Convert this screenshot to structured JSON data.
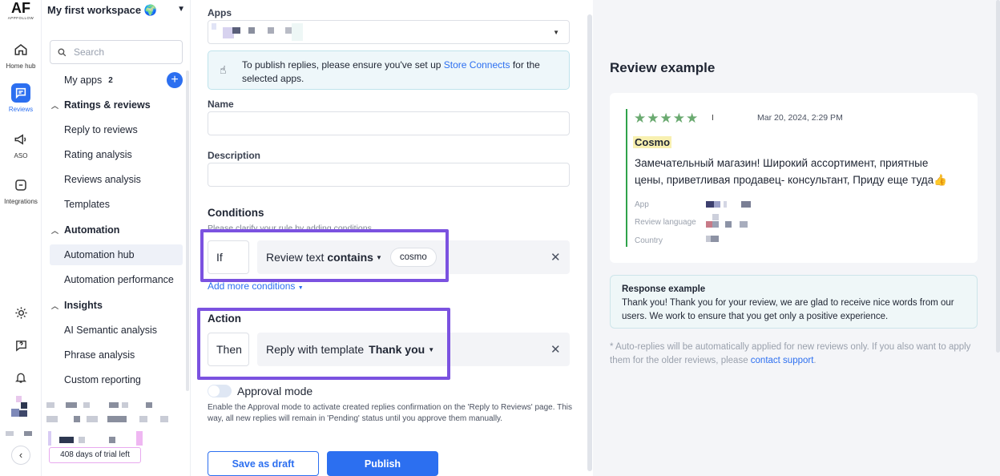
{
  "logo": {
    "mark": "AF",
    "sub": "APPFOLLOW"
  },
  "rail": {
    "items": [
      {
        "label": "Home hub"
      },
      {
        "label": "Reviews"
      },
      {
        "label": "ASO"
      },
      {
        "label": "Integrations"
      }
    ]
  },
  "sidebar": {
    "workspace": "My first workspace 🌍",
    "search_placeholder": "Search",
    "my_apps": {
      "label": "My apps",
      "count": "2"
    },
    "sections": [
      {
        "title": "Ratings & reviews",
        "items": [
          "Reply to reviews",
          "Rating analysis",
          "Reviews analysis",
          "Templates"
        ]
      },
      {
        "title": "Automation",
        "items": [
          "Automation hub",
          "Automation performance"
        ]
      },
      {
        "title": "Insights",
        "items": [
          "AI Semantic analysis",
          "Phrase analysis",
          "Custom reporting"
        ]
      }
    ],
    "trial": "408 days of trial left"
  },
  "form": {
    "apps_label": "Apps",
    "note": {
      "prefix": "To publish replies, please ensure you've set up ",
      "link": "Store Connects",
      "suffix": " for the selected apps."
    },
    "name_label": "Name",
    "description_label": "Description",
    "conditions_title": "Conditions",
    "conditions_sub": "Please clarify your rule by adding conditions",
    "if_label": "If",
    "condition_field": "Review text",
    "condition_op": "contains",
    "condition_value": "cosmo",
    "add_more": "Add more conditions",
    "action_title": "Action",
    "then_label": "Then",
    "action_text": "Reply with template",
    "action_template": "Thank you",
    "approval_label": "Approval mode",
    "approval_desc": "Enable the Approval mode to activate created replies confirmation on the 'Reply to Reviews' page. This way, all new replies will remain in 'Pending' status until you approve them manually.",
    "save_draft": "Save as draft",
    "publish": "Publish"
  },
  "preview": {
    "title": "Review example",
    "stars": "★★★★★",
    "separator": "I",
    "date": "Mar 20, 2024, 2:29 PM",
    "author": "Cosmo",
    "text": "Замечательный магазин! Широкий ассортимент, приятные цены, приветливая продавец- консультант, Приду еще туда👍",
    "meta": {
      "app": "App",
      "language": "Review language",
      "country": "Country"
    },
    "response_title": "Response example",
    "response_text": "Thank you! Thank you for your review, we are glad to receive nice words from our users. We work to ensure that you get only a positive experience.",
    "footnote_prefix": "* Auto-replies will be automatically applied for new reviews only. If you also want to apply them for the older reviews, please ",
    "footnote_link": "contact support",
    "footnote_suffix": "."
  }
}
